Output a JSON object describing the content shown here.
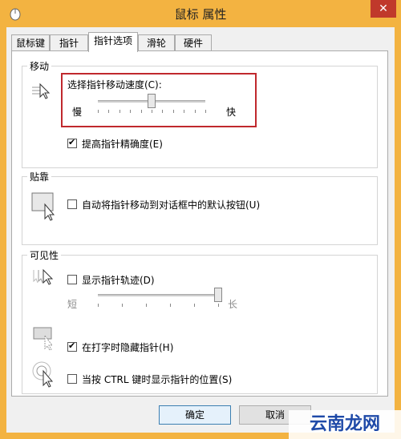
{
  "window": {
    "title": "鼠标 属性",
    "close_label": "✕"
  },
  "tabs": [
    {
      "label": "鼠标键"
    },
    {
      "label": "指针"
    },
    {
      "label": "指针选项"
    },
    {
      "label": "滑轮"
    },
    {
      "label": "硬件"
    }
  ],
  "motion": {
    "group_title": "移动",
    "speed_label": "选择指针移动速度(C):",
    "slow": "慢",
    "fast": "快",
    "speed_level": 0.5,
    "precision_label": "提高指针精确度(E)",
    "precision_checked": true
  },
  "snap": {
    "group_title": "贴靠",
    "snap_label": "自动将指针移动到对话框中的默认按钮(U)",
    "snap_checked": false
  },
  "visibility": {
    "group_title": "可见性",
    "trails_label": "显示指针轨迹(D)",
    "trails_checked": false,
    "short": "短",
    "long": "长",
    "trail_level": 1.0,
    "hide_label": "在打字时隐藏指针(H)",
    "hide_checked": true,
    "ctrl_label": "当按 CTRL 键时显示指针的位置(S)",
    "ctrl_checked": false
  },
  "buttons": {
    "ok": "确定",
    "cancel": "取消"
  },
  "watermark": "云南龙网",
  "colors": {
    "highlight": "#c0282d",
    "accent": "#f3b341"
  }
}
